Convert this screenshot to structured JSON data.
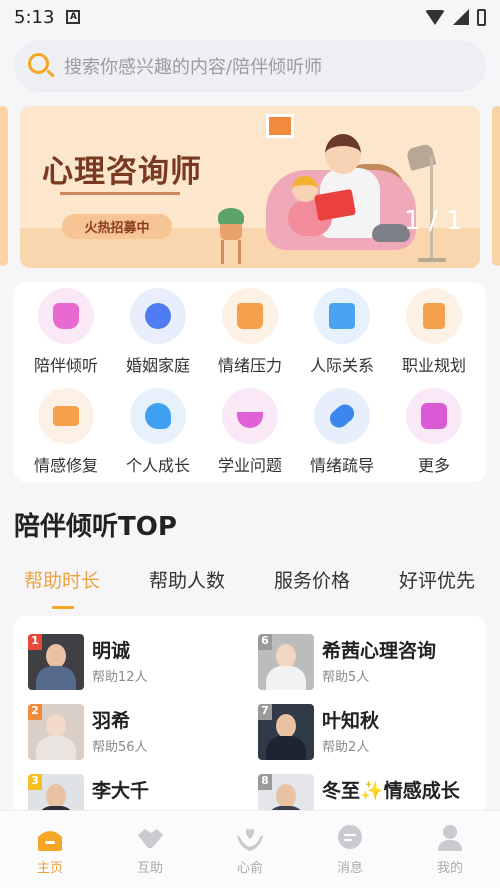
{
  "status_bar": {
    "time": "5:13",
    "notification_icon": "A"
  },
  "search": {
    "placeholder": "搜索你感兴趣的内容/陪伴倾听师"
  },
  "banner": {
    "title": "心理咨询师",
    "badge": "火热招募中",
    "page_current": "1",
    "page_separator": "/",
    "page_total": "1"
  },
  "categories": [
    {
      "label": "陪伴倾听",
      "icon": "basket-icon",
      "color": "#e86ad0"
    },
    {
      "label": "婚姻家庭",
      "icon": "clover-icon",
      "color": "#4f7cf0"
    },
    {
      "label": "情绪压力",
      "icon": "bag-icon",
      "color": "#f5a04a"
    },
    {
      "label": "人际关系",
      "icon": "folder-icon",
      "color": "#4aa3f0"
    },
    {
      "label": "职业规划",
      "icon": "clipboard-icon",
      "color": "#f5a04a"
    },
    {
      "label": "情感修复",
      "icon": "ambulance-icon",
      "color": "#f5a04a"
    },
    {
      "label": "个人成长",
      "icon": "head-icon",
      "color": "#3ea0f0"
    },
    {
      "label": "学业问题",
      "icon": "moon-icon",
      "color": "#e060d8"
    },
    {
      "label": "情绪疏导",
      "icon": "pill-icon",
      "color": "#3d86f0"
    },
    {
      "label": "更多",
      "icon": "plus-icon",
      "color": "#d95ad4"
    }
  ],
  "section": {
    "title": "陪伴倾听TOP"
  },
  "tabs": [
    {
      "label": "帮助时长",
      "active": true
    },
    {
      "label": "帮助人数",
      "active": false
    },
    {
      "label": "服务价格",
      "active": false
    },
    {
      "label": "好评优先",
      "active": false
    }
  ],
  "listeners": [
    {
      "rank": "1",
      "name": "明诚",
      "sub": "帮助12人",
      "rank_color": "#e84a3a"
    },
    {
      "rank": "6",
      "name": "希茜心理咨询",
      "sub": "帮助5人",
      "rank_color": "#9a9a9a"
    },
    {
      "rank": "2",
      "name": "羽希",
      "sub": "帮助56人",
      "rank_color": "#f08a3c"
    },
    {
      "rank": "7",
      "name": "叶知秋",
      "sub": "帮助2人",
      "rank_color": "#9a9a9a"
    },
    {
      "rank": "3",
      "name": "李大千",
      "sub": "",
      "rank_color": "#f5c023"
    },
    {
      "rank": "8",
      "name_a": "冬至",
      "sparkle": "✨",
      "name_b": "情感成长",
      "sub": "",
      "rank_color": "#9a9a9a"
    }
  ],
  "bottom_nav": [
    {
      "label": "主页",
      "icon": "home-icon",
      "active": true
    },
    {
      "label": "互助",
      "icon": "handshake-icon",
      "active": false
    },
    {
      "label": "心俞",
      "icon": "heart-hands-icon",
      "active": false
    },
    {
      "label": "消息",
      "icon": "message-icon",
      "active": false
    },
    {
      "label": "我的",
      "icon": "user-icon",
      "active": false
    }
  ],
  "colors": {
    "accent": "#f5a623",
    "active_tab": "#f0a23a"
  }
}
